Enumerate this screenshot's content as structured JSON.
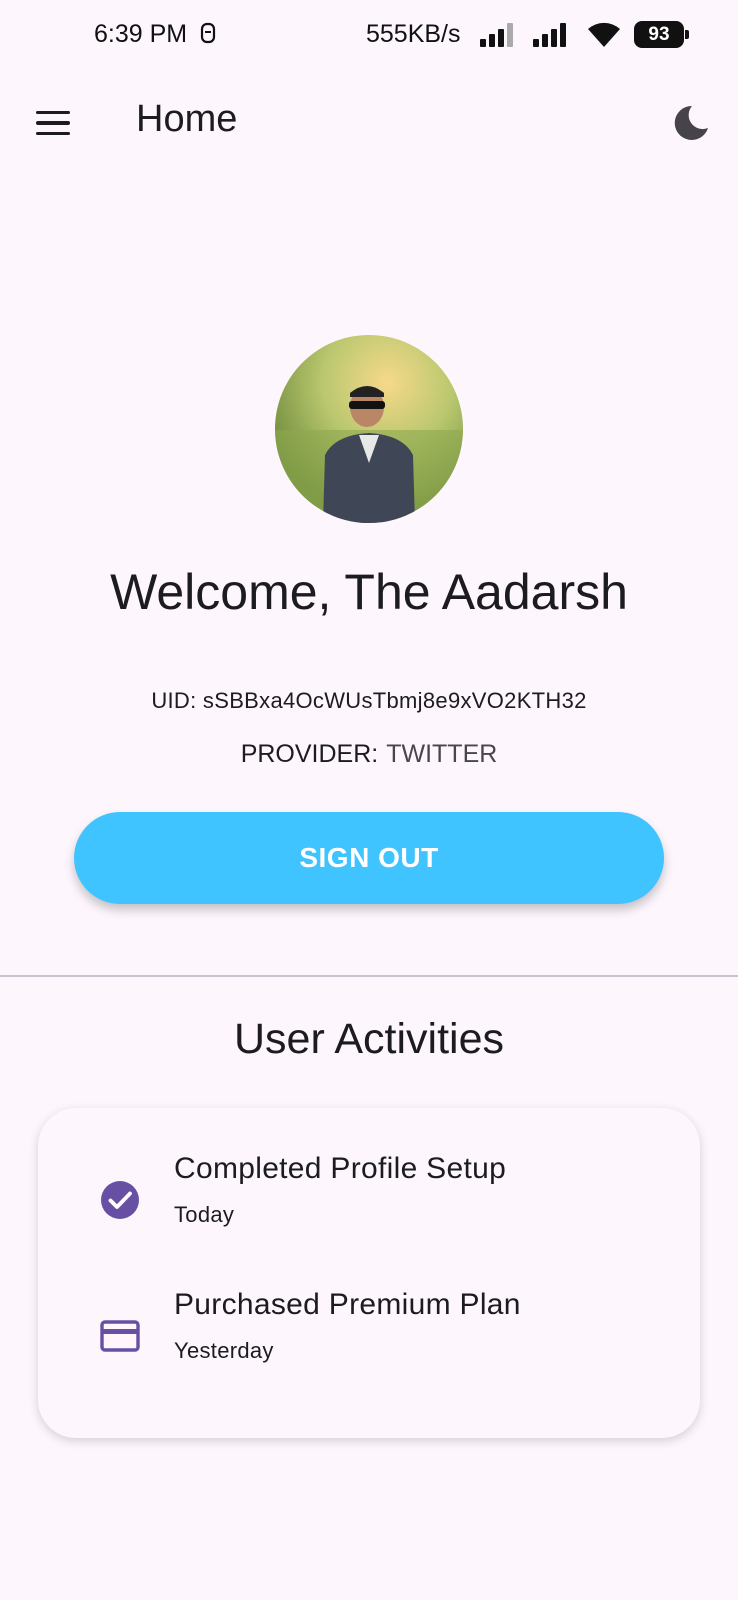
{
  "status_bar": {
    "time": "6:39 PM",
    "net_speed": "555KB/s",
    "battery": "93"
  },
  "app_bar": {
    "title": "Home",
    "menu_icon": "hamburger-menu-icon",
    "theme_icon": "dark-mode-moon-icon"
  },
  "profile": {
    "welcome": "Welcome, The Aadarsh",
    "uid": "UID: sSBBxa4OcWUsTbmj8e9xVO2KTH32",
    "provider_label": "PROVIDER:",
    "provider_value": "TWITTER",
    "sign_out_label": "SIGN OUT"
  },
  "activities": {
    "title": "User Activities",
    "items": [
      {
        "icon": "check-circle-icon",
        "title": "Completed Profile Setup",
        "time": "Today"
      },
      {
        "icon": "credit-card-icon",
        "title": "Purchased Premium Plan",
        "time": "Yesterday"
      }
    ]
  },
  "colors": {
    "background": "#FDF7FD",
    "sign_out_button": "#40C4FF",
    "activity_icon": "#6750A4",
    "text": "#1C1B1F"
  }
}
